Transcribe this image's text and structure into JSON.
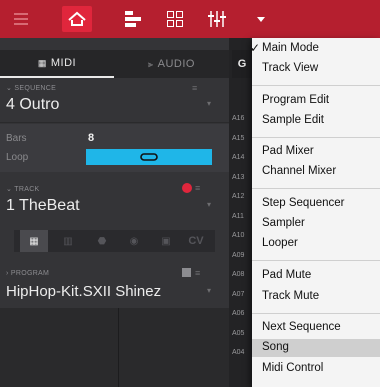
{
  "toolbar": {
    "menu_icon": "hamburger-icon",
    "main_mode_icon": "house-icon",
    "track_view_icon": "bars-icon",
    "pad_icon": "grid-icon",
    "mixer_icon": "sliders-icon",
    "dropdown_icon": "caret-down-icon"
  },
  "tabs": {
    "midi": "MIDI",
    "audio": "AUDIO",
    "grid": "G"
  },
  "sequence": {
    "section_label": "SEQUENCE",
    "name": "4 Outro",
    "bars_label": "Bars",
    "bars_value": "8",
    "loop_label": "Loop"
  },
  "track": {
    "section_label": "TRACK",
    "name": "1 TheBeat",
    "cv_label": "CV"
  },
  "program": {
    "section_label": "PROGRAM",
    "name": "HipHop-Kit.SXII Shinez"
  },
  "row_labels": [
    "A16",
    "A15",
    "A14",
    "A13",
    "A12",
    "A11",
    "A10",
    "A09",
    "A08",
    "A07",
    "A06",
    "A05",
    "A04"
  ],
  "menu": {
    "items": [
      {
        "label": "Main Mode",
        "checked": true
      },
      {
        "label": "Track View"
      },
      {
        "label": "Program Edit"
      },
      {
        "label": "Sample Edit"
      },
      {
        "label": "Pad Mixer"
      },
      {
        "label": "Channel Mixer"
      },
      {
        "label": "Step Sequencer"
      },
      {
        "label": "Sampler"
      },
      {
        "label": "Looper"
      },
      {
        "label": "Pad Mute"
      },
      {
        "label": "Track Mute"
      },
      {
        "label": "Next Sequence"
      },
      {
        "label": "Song",
        "selected": true
      },
      {
        "label": "Midi Control"
      }
    ]
  },
  "colors": {
    "brand_red": "#b51f2f",
    "accent_cyan": "#1fb6e8",
    "active_red": "#e0263c"
  }
}
